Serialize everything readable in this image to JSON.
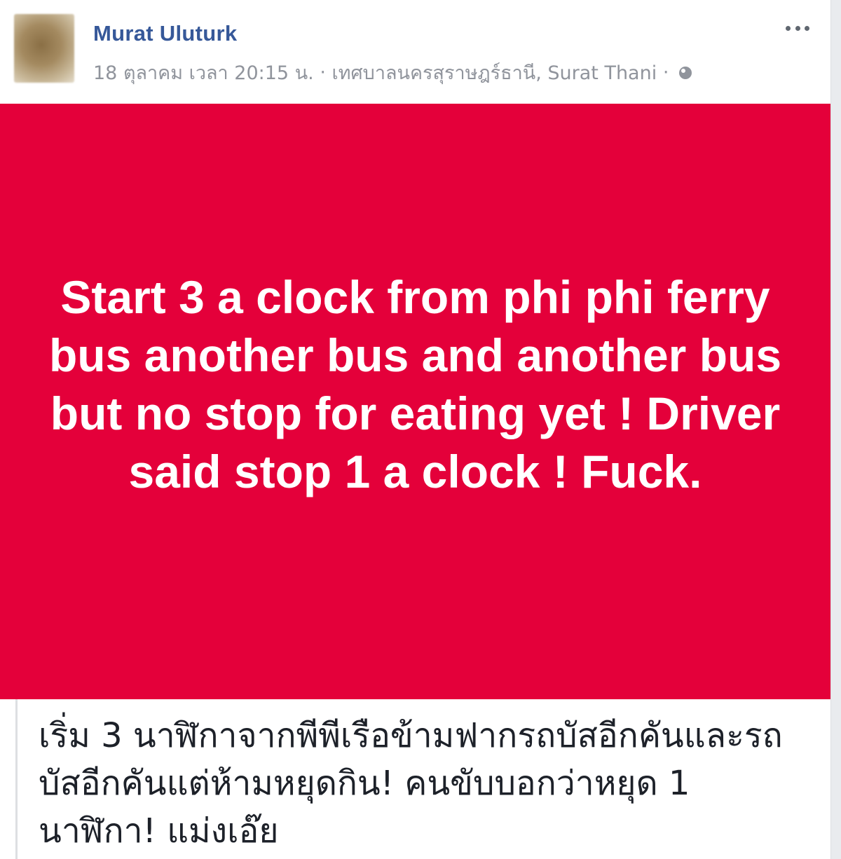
{
  "post": {
    "author": "Murat Uluturk",
    "meta_date": "18 ตุลาคม เวลา 20:15 น.",
    "meta_separator": "·",
    "meta_location": "เทศบาลนครสุราษฎร์ธานี, Surat Thani",
    "privacy_icon": "globe-icon",
    "options_icon": "more-options-icon",
    "card_background": "#e4003a",
    "card_text": "Start 3 a clock from phi phi ferry bus another bus and another bus but no stop for eating yet ! Driver said stop 1 a clock ! Fuck.",
    "caption": "เริ่ม 3 นาฬิกาจากพีพีเรือข้ามฟากรถบัสอีกคันและรถบัสอีกคันแต่ห้ามหยุดกิน! คนขับบอกว่าหยุด 1 นาฬิกา! แม่งเอ๊ย"
  }
}
